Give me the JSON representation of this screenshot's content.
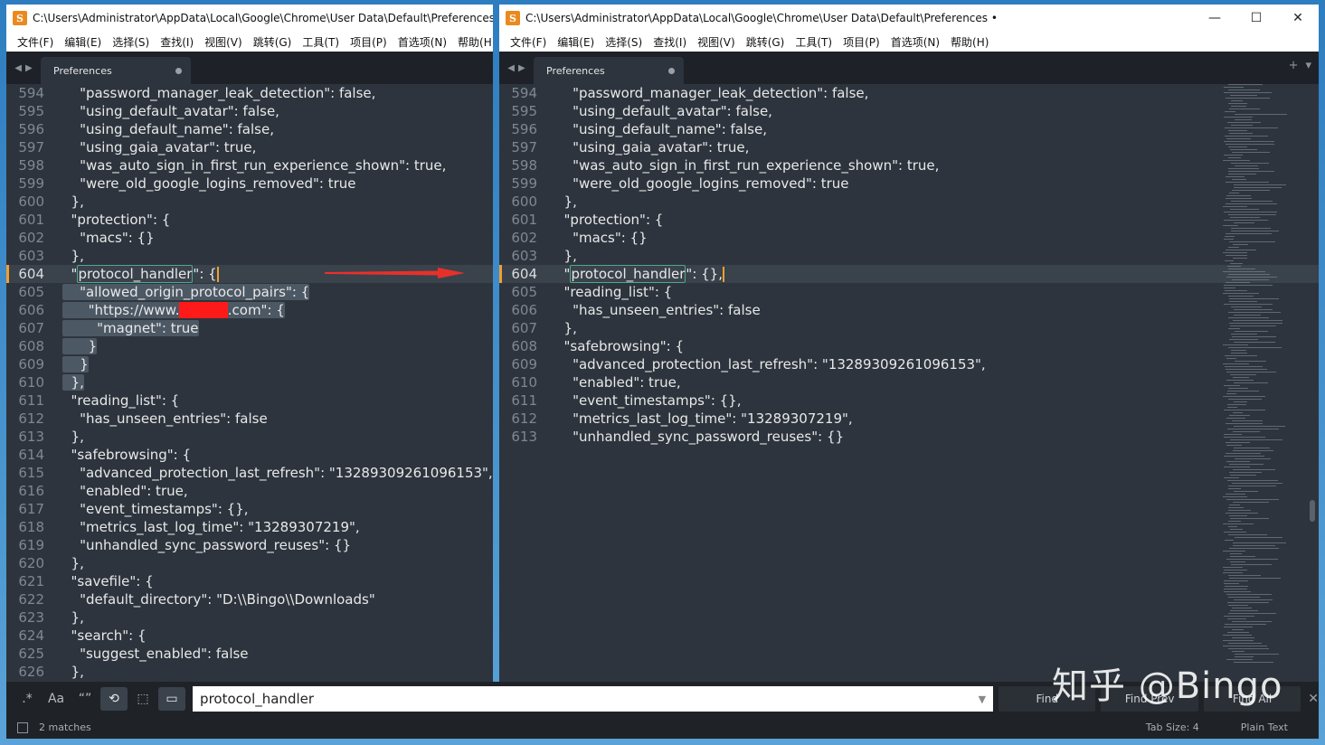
{
  "left_window": {
    "title": "C:\\Users\\Administrator\\AppData\\Local\\Google\\Chrome\\User Data\\Default\\Preferences",
    "menu": [
      "文件(F)",
      "编辑(E)",
      "选择(S)",
      "查找(I)",
      "视图(V)",
      "跳转(G)",
      "工具(T)",
      "项目(P)",
      "首选项(N)",
      "帮助(H)"
    ],
    "tab_label": "Preferences",
    "lines": [
      {
        "n": "594",
        "text": "    \"password_manager_leak_detection\": false,"
      },
      {
        "n": "595",
        "text": "    \"using_default_avatar\": false,"
      },
      {
        "n": "596",
        "text": "    \"using_default_name\": false,"
      },
      {
        "n": "597",
        "text": "    \"using_gaia_avatar\": true,"
      },
      {
        "n": "598",
        "text": "    \"was_auto_sign_in_first_run_experience_shown\": true,"
      },
      {
        "n": "599",
        "text": "    \"were_old_google_logins_removed\": true"
      },
      {
        "n": "600",
        "text": "  },"
      },
      {
        "n": "601",
        "text": "  \"protection\": {"
      },
      {
        "n": "602",
        "text": "    \"macs\": {}"
      },
      {
        "n": "603",
        "text": "  },"
      },
      {
        "n": "604",
        "pre": "  \"",
        "match": "protocol_handler",
        "post": "\": {"
      },
      {
        "n": "605",
        "text": "    \"allowed_origin_protocol_pairs\": {"
      },
      {
        "n": "606",
        "pre": "      \"https://www.",
        "redacted": "xxxxxx",
        "post": ".com\": {"
      },
      {
        "n": "607",
        "text": "        \"magnet\": true"
      },
      {
        "n": "608",
        "text": "      }"
      },
      {
        "n": "609",
        "text": "    }"
      },
      {
        "n": "610",
        "text": "  },"
      },
      {
        "n": "611",
        "text": "  \"reading_list\": {"
      },
      {
        "n": "612",
        "text": "    \"has_unseen_entries\": false"
      },
      {
        "n": "613",
        "text": "  },"
      },
      {
        "n": "614",
        "text": "  \"safebrowsing\": {"
      },
      {
        "n": "615",
        "text": "    \"advanced_protection_last_refresh\": \"13289309261096153\","
      },
      {
        "n": "616",
        "text": "    \"enabled\": true,"
      },
      {
        "n": "617",
        "text": "    \"event_timestamps\": {},"
      },
      {
        "n": "618",
        "text": "    \"metrics_last_log_time\": \"13289307219\","
      },
      {
        "n": "619",
        "text": "    \"unhandled_sync_password_reuses\": {}"
      },
      {
        "n": "620",
        "text": "  },"
      },
      {
        "n": "621",
        "text": "  \"savefile\": {"
      },
      {
        "n": "622",
        "text": "    \"default_directory\": \"D:\\\\Bingo\\\\Downloads\""
      },
      {
        "n": "623",
        "text": "  },"
      },
      {
        "n": "624",
        "text": "  \"search\": {"
      },
      {
        "n": "625",
        "text": "    \"suggest_enabled\": false"
      },
      {
        "n": "626",
        "text": "  },"
      }
    ]
  },
  "right_window": {
    "title": "C:\\Users\\Administrator\\AppData\\Local\\Google\\Chrome\\User Data\\Default\\Preferences •",
    "menu": [
      "文件(F)",
      "编辑(E)",
      "选择(S)",
      "查找(I)",
      "视图(V)",
      "跳转(G)",
      "工具(T)",
      "项目(P)",
      "首选项(N)",
      "帮助(H)"
    ],
    "tab_label": "Preferences",
    "lines": [
      {
        "n": "594",
        "text": "    \"password_manager_leak_detection\": false,"
      },
      {
        "n": "595",
        "text": "    \"using_default_avatar\": false,"
      },
      {
        "n": "596",
        "text": "    \"using_default_name\": false,"
      },
      {
        "n": "597",
        "text": "    \"using_gaia_avatar\": true,"
      },
      {
        "n": "598",
        "text": "    \"was_auto_sign_in_first_run_experience_shown\": true,"
      },
      {
        "n": "599",
        "text": "    \"were_old_google_logins_removed\": true"
      },
      {
        "n": "600",
        "text": "  },"
      },
      {
        "n": "601",
        "text": "  \"protection\": {"
      },
      {
        "n": "602",
        "text": "    \"macs\": {}"
      },
      {
        "n": "603",
        "text": "  },"
      },
      {
        "n": "604",
        "pre": "  \"",
        "match": "protocol_handler",
        "post": "\": {},"
      },
      {
        "n": "605",
        "text": "  \"reading_list\": {"
      },
      {
        "n": "606",
        "text": "    \"has_unseen_entries\": false"
      },
      {
        "n": "607",
        "text": "  },"
      },
      {
        "n": "608",
        "text": "  \"safebrowsing\": {"
      },
      {
        "n": "609",
        "text": "    \"advanced_protection_last_refresh\": \"13289309261096153\","
      },
      {
        "n": "610",
        "text": "    \"enabled\": true,"
      },
      {
        "n": "611",
        "text": "    \"event_timestamps\": {},"
      },
      {
        "n": "612",
        "text": "    \"metrics_last_log_time\": \"13289307219\","
      },
      {
        "n": "613",
        "text": "    \"unhandled_sync_password_reuses\": {}"
      }
    ]
  },
  "find_panel": {
    "regex_label": ".*",
    "case_label": "Aa",
    "word_label": "“”",
    "wrap_label": "⟲",
    "selection_label": "⬚",
    "highlight_label": "▭",
    "query": "protocol_handler",
    "find_label": "Find",
    "find_prev_label": "Find Prev",
    "find_all_label": "Find All"
  },
  "status_bar": {
    "matches": "2 matches",
    "tab_size": "Tab Size: 4",
    "syntax": "Plain Text"
  },
  "watermark": "知乎 @Bingo",
  "colors": {
    "accent_orange": "#f0a030",
    "editor_bg": "#2d343d",
    "redaction": "#ff1a1a",
    "arrow": "#e8302a"
  }
}
